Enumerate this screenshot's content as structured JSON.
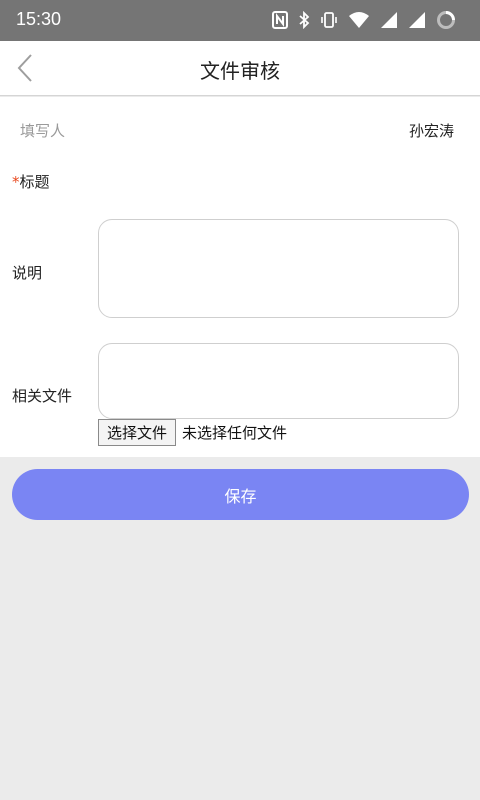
{
  "status_bar": {
    "time": "15:30"
  },
  "header": {
    "title": "文件审核"
  },
  "form": {
    "author_label": "填写人",
    "author_value": "孙宏涛",
    "title_required_mark": "*",
    "title_label": "标题",
    "description_label": "说明",
    "files_label": "相关文件",
    "choose_file_button": "选择文件",
    "no_file_text": "未选择任何文件"
  },
  "actions": {
    "save_label": "保存"
  },
  "colors": {
    "status_bar_bg": "#757575",
    "primary_button": "#7a85f3",
    "required_mark": "#e8481e",
    "page_bg": "#ebebeb"
  }
}
